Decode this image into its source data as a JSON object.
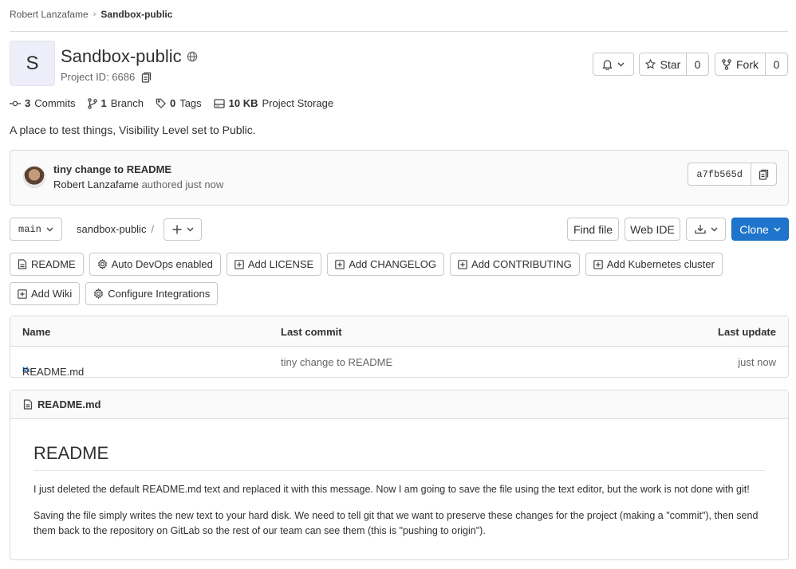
{
  "breadcrumb": {
    "owner": "Robert Lanzafame",
    "project": "Sandbox-public"
  },
  "project": {
    "avatar_letter": "S",
    "name": "Sandbox-public",
    "id_label": "Project ID: 6686",
    "description": "A place to test things, Visibility Level set to Public."
  },
  "actions": {
    "star_label": "Star",
    "star_count": "0",
    "fork_label": "Fork",
    "fork_count": "0"
  },
  "stats": {
    "commits_count": "3",
    "commits_label": "Commits",
    "branch_count": "1",
    "branch_label": "Branch",
    "tags_count": "0",
    "tags_label": "Tags",
    "storage_size": "10 KB",
    "storage_label": "Project Storage"
  },
  "last_commit": {
    "title": "tiny change to README",
    "author": "Robert Lanzafame",
    "meta": "authored just now",
    "sha": "a7fb565d"
  },
  "toolbar": {
    "branch": "main",
    "path": "sandbox-public",
    "path_sep": "/",
    "find_file": "Find file",
    "web_ide": "Web IDE",
    "clone": "Clone"
  },
  "quick_actions": [
    {
      "label": "README",
      "icon": "file-icon"
    },
    {
      "label": "Auto DevOps enabled",
      "icon": "gear-icon"
    },
    {
      "label": "Add LICENSE",
      "icon": "plus-square-icon"
    },
    {
      "label": "Add CHANGELOG",
      "icon": "plus-square-icon"
    },
    {
      "label": "Add CONTRIBUTING",
      "icon": "plus-square-icon"
    },
    {
      "label": "Add Kubernetes cluster",
      "icon": "plus-square-icon"
    },
    {
      "label": "Add Wiki",
      "icon": "plus-square-icon"
    },
    {
      "label": "Configure Integrations",
      "icon": "gear-icon"
    }
  ],
  "file_table": {
    "headers": {
      "name": "Name",
      "last_commit": "Last commit",
      "last_update": "Last update"
    },
    "rows": [
      {
        "name": "README.md",
        "icon_text": "M↓",
        "commit": "tiny change to README",
        "update": "just now"
      }
    ]
  },
  "readme": {
    "filename": "README.md",
    "heading": "README",
    "paragraphs": [
      "I just deleted the default README.md text and replaced it with this message. Now I am going to save the file using the text editor, but the work is not done with git!",
      "Saving the file simply writes the new text to your hard disk. We need to tell git that we want to preserve these changes for the project (making a \"commit\"), then send them back to the repository on GitLab so the rest of our team can see them (this is \"pushing to origin\")."
    ]
  },
  "colors": {
    "primary": "#1f75cb",
    "avatar_bg": "#eeeefa"
  }
}
